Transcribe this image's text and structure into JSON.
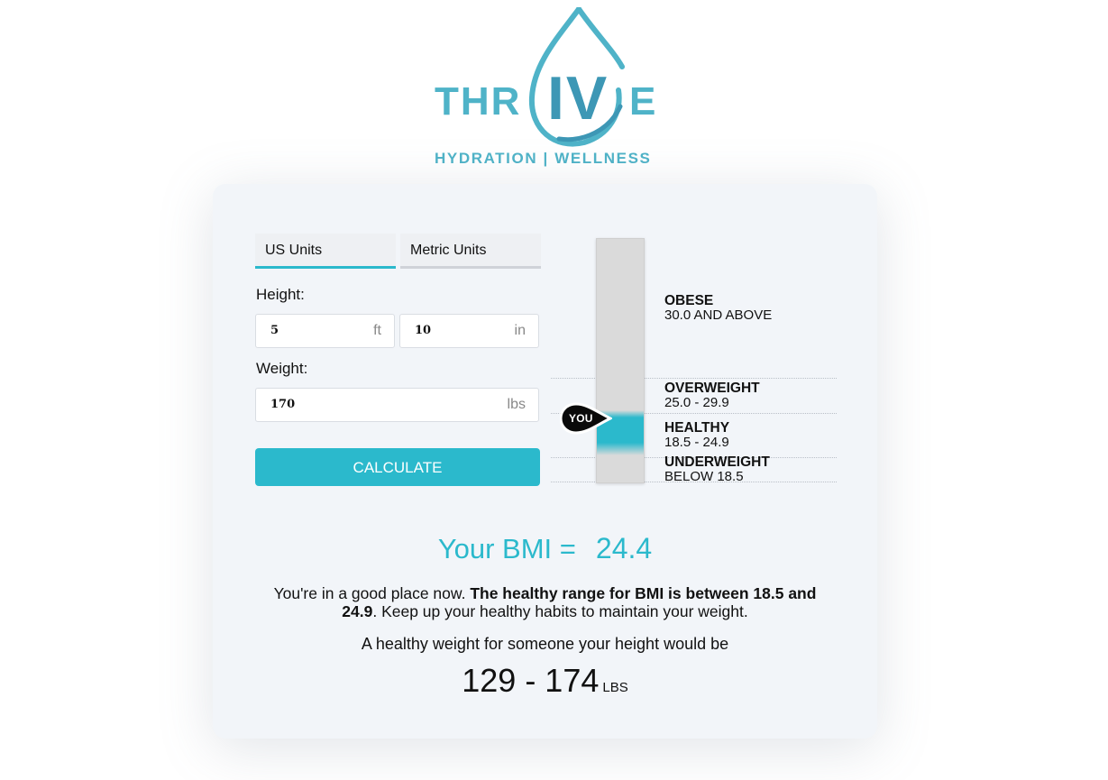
{
  "brand": {
    "word_left": "THR",
    "word_iv": "IV",
    "word_right": "E",
    "tagline": "HYDRATION | WELLNESS"
  },
  "tabs": {
    "us": "US Units",
    "metric": "Metric Units",
    "active": "us"
  },
  "form": {
    "height_label": "Height:",
    "height_ft_value": "5",
    "height_ft_unit": "ft",
    "height_in_value": "10",
    "height_in_unit": "in",
    "weight_label": "Weight:",
    "weight_value": "170",
    "weight_unit": "lbs",
    "calculate_label": "CALCULATE"
  },
  "gauge": {
    "marker_label": "YOU",
    "marker_bmi": 24.4,
    "ranges": [
      {
        "name": "OBESE",
        "value": "30.0 AND ABOVE"
      },
      {
        "name": "OVERWEIGHT",
        "value": "25.0 - 29.9"
      },
      {
        "name": "HEALTHY",
        "value": "18.5 - 24.9"
      },
      {
        "name": "UNDERWEIGHT",
        "value": "BELOW 18.5"
      }
    ],
    "accent": "#2bb9cc"
  },
  "result": {
    "bmi_label": "Your BMI =",
    "bmi_value": "24.4",
    "message_intro": "You're in a good place now.",
    "message_bold": "The healthy range for BMI is between 18.5 and 24.9",
    "message_outro": ". Keep up your healthy habits to maintain your weight.",
    "healthy_weight_text": "A healthy weight for someone your height would be",
    "healthy_weight_range": "129 - 174",
    "healthy_weight_unit": "LBS"
  },
  "colors": {
    "brand_teal": "#4fb3c8",
    "brand_blue": "#3d97b5",
    "accent": "#2bb9cc",
    "card_bg": "#f2f5f9"
  }
}
